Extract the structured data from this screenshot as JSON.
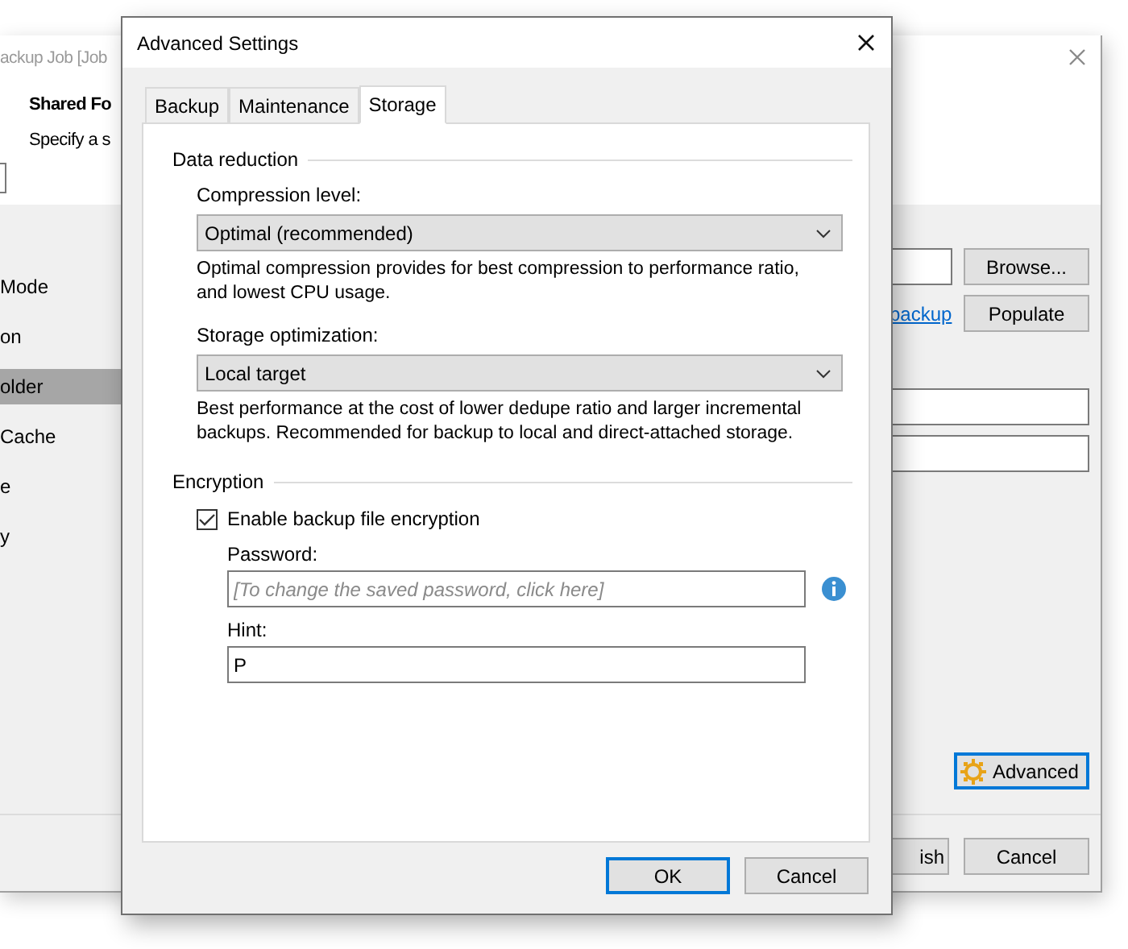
{
  "background_window": {
    "title": "ackup Job [Job",
    "header_title": "Shared Fo",
    "header_subtitle": "Specify a s",
    "steps": [
      {
        "label": "Mode",
        "selected": false
      },
      {
        "label": "on",
        "selected": false
      },
      {
        "label": "older",
        "selected": true
      },
      {
        "label": "Cache",
        "selected": false
      },
      {
        "label": "e",
        "selected": false
      },
      {
        "label": "y",
        "selected": false
      }
    ],
    "browse_button": "Browse...",
    "link": "backup",
    "populate_button": "Populate",
    "advanced_button": "Advanced",
    "buttons": [
      "ish",
      "Cancel"
    ]
  },
  "dialog": {
    "title": "Advanced Settings",
    "tabs": [
      {
        "label": "Backup",
        "selected": false
      },
      {
        "label": "Maintenance",
        "selected": false
      },
      {
        "label": "Storage",
        "selected": true
      }
    ],
    "data_reduction": {
      "heading": "Data reduction",
      "compression": {
        "label": "Compression level:",
        "value": "Optimal (recommended)",
        "description": "Optimal compression provides for best compression to performance ratio, and lowest CPU usage."
      },
      "storage_optimization": {
        "label": "Storage optimization:",
        "value": "Local target",
        "description": "Best performance at the cost of lower dedupe ratio and larger incremental backups. Recommended for backup to local and direct-attached storage."
      }
    },
    "encryption": {
      "heading": "Encryption",
      "enable": {
        "label": "Enable backup file encryption",
        "checked": true
      },
      "password": {
        "label": "Password:",
        "placeholder": "[To change the saved password, click here]"
      },
      "hint": {
        "label": "Hint:",
        "value": "P"
      }
    },
    "buttons": [
      "OK",
      "Cancel"
    ]
  }
}
